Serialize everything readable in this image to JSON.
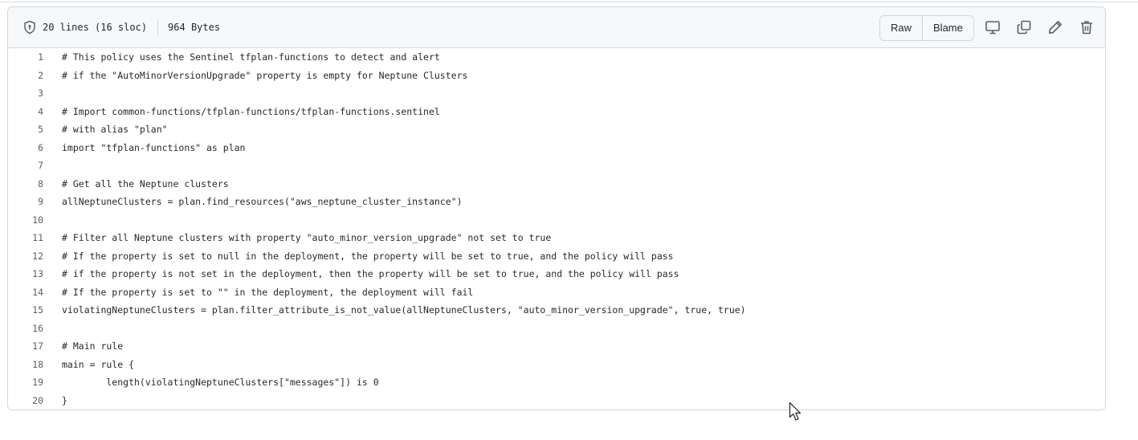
{
  "file_info": {
    "lines": "20 lines (16 sloc)",
    "size": "964 Bytes",
    "shield_icon": "shield-icon"
  },
  "actions": {
    "raw_label": "Raw",
    "blame_label": "Blame",
    "icons": [
      "desktop-icon",
      "copy-icon",
      "pencil-icon",
      "trash-icon"
    ]
  },
  "code": [
    {
      "n": "1",
      "text": "# This policy uses the Sentinel tfplan-functions to detect and alert"
    },
    {
      "n": "2",
      "text": "# if the \"AutoMinorVersionUpgrade\" property is empty for Neptune Clusters"
    },
    {
      "n": "3",
      "text": ""
    },
    {
      "n": "4",
      "text": "# Import common-functions/tfplan-functions/tfplan-functions.sentinel"
    },
    {
      "n": "5",
      "text": "# with alias \"plan\""
    },
    {
      "n": "6",
      "text": "import \"tfplan-functions\" as plan"
    },
    {
      "n": "7",
      "text": ""
    },
    {
      "n": "8",
      "text": "# Get all the Neptune clusters"
    },
    {
      "n": "9",
      "text": "allNeptuneClusters = plan.find_resources(\"aws_neptune_cluster_instance\")"
    },
    {
      "n": "10",
      "text": ""
    },
    {
      "n": "11",
      "text": "# Filter all Neptune clusters with property \"auto_minor_version_upgrade\" not set to true"
    },
    {
      "n": "12",
      "text": "# If the property is set to null in the deployment, the property will be set to true, and the policy will pass"
    },
    {
      "n": "13",
      "text": "# if the property is not set in the deployment, then the property will be set to true, and the policy will pass"
    },
    {
      "n": "14",
      "text": "# If the property is set to \"\" in the deployment, the deployment will fail"
    },
    {
      "n": "15",
      "text": "violatingNeptuneClusters = plan.filter_attribute_is_not_value(allNeptuneClusters, \"auto_minor_version_upgrade\", true, true)"
    },
    {
      "n": "16",
      "text": ""
    },
    {
      "n": "17",
      "text": "# Main rule"
    },
    {
      "n": "18",
      "text": "main = rule {"
    },
    {
      "n": "19",
      "text": "        length(violatingNeptuneClusters[\"messages\"]) is 0"
    },
    {
      "n": "20",
      "text": "}"
    }
  ]
}
